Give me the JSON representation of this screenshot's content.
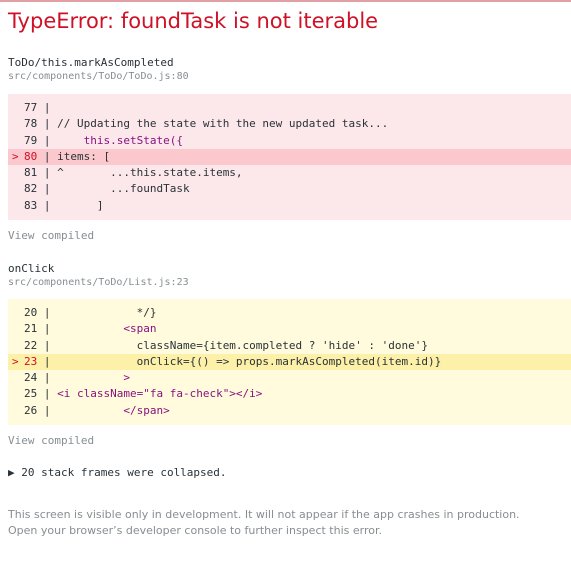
{
  "error": {
    "title": "TypeError: foundTask is not iterable"
  },
  "frames": [
    {
      "function": "ToDo/this.markAsCompleted",
      "file": "src/components/ToDo/ToDo.js:80",
      "view_compiled": "View compiled",
      "lines": [
        {
          "num": "77",
          "code": ""
        },
        {
          "num": "78",
          "code": "// Updating the state with the new updated task..."
        },
        {
          "num": "79",
          "code": "    this.setState({"
        },
        {
          "num": "80",
          "code": "items: [",
          "highlight": true
        },
        {
          "num": "81",
          "code": "^       ...this.state.items,"
        },
        {
          "num": "82",
          "code": "        ...foundTask"
        },
        {
          "num": "83",
          "code": "      ]"
        }
      ]
    },
    {
      "function": "onClick",
      "file": "src/components/ToDo/List.js:23",
      "view_compiled": "View compiled",
      "lines": [
        {
          "num": "20",
          "code": "            */}"
        },
        {
          "num": "21",
          "code": "          <span"
        },
        {
          "num": "22",
          "code": "            className={item.completed ? 'hide' : 'done'}"
        },
        {
          "num": "23",
          "code": "            onClick={() => props.markAsCompleted(item.id)}",
          "highlight": true
        },
        {
          "num": "24",
          "code": "          >"
        },
        {
          "num": "25",
          "code": "<i className=\"fa fa-check\"></i>"
        },
        {
          "num": "26",
          "code": "          </span>"
        }
      ]
    }
  ],
  "collapsed": "▶ 20 stack frames were collapsed.",
  "footer": {
    "line1": "This screen is visible only in development. It will not appear if the app crashes in production.",
    "line2": "Open your browser’s developer console to further inspect this error."
  },
  "colors": {
    "error_red": "#ce1126",
    "muted": "#878e91",
    "red_bg": "#fce8ea",
    "red_highlight": "#fbc9cd",
    "yellow_bg": "#fffbdc",
    "yellow_highlight": "#fdf1a9"
  }
}
